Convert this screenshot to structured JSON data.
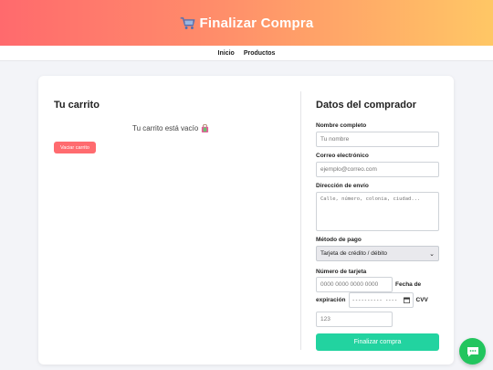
{
  "header": {
    "title": "Finalizar Compra",
    "icon": "shopping-cart-icon"
  },
  "nav": {
    "items": [
      "Inicio",
      "Productos"
    ]
  },
  "cart": {
    "title": "Tu carrito",
    "empty_message": "Tu carrito está vacío",
    "clear_button": "Vaciar carrito",
    "empty_icon": "shopping-bag-icon"
  },
  "buyer": {
    "title": "Datos del comprador",
    "name_label": "Nombre completo",
    "name_placeholder": "Tu nombre",
    "email_label": "Correo electrónico",
    "email_placeholder": "ejemplo@correo.com",
    "address_label": "Dirección de envío",
    "address_placeholder": "Calle, número, colonia, ciudad...",
    "payment_label": "Método de pago",
    "payment_selected": "Tarjeta de crédito / débito",
    "card_label": "Número de tarjeta",
    "card_placeholder": "0000 0000 0000 0000",
    "expiry_label_1": "Fecha de",
    "expiry_label_2": "expiración",
    "expiry_placeholder": "---------- ----",
    "cvv_label": "CVV",
    "cvv_placeholder": "123",
    "submit_button": "Finalizar compra"
  },
  "colors": {
    "header_start": "#ff6a6d",
    "header_end": "#ffc765",
    "clear_button": "#ff6b6f",
    "submit_button": "#22d3a0",
    "chat_button": "#22c55e"
  },
  "chat": {
    "icon": "chat-bubble-icon"
  }
}
